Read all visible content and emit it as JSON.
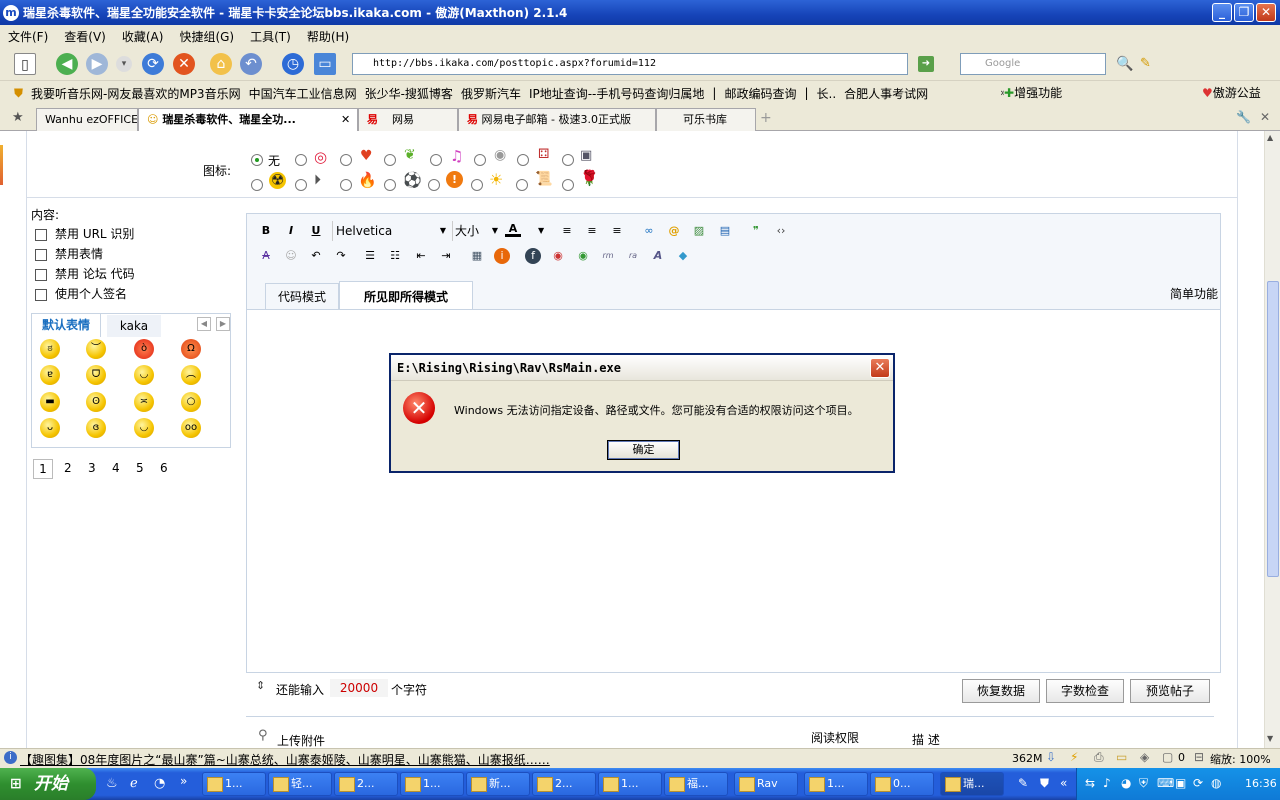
{
  "window": {
    "title": "瑞星杀毒软件、瑞星全功能安全软件 - 瑞星卡卡安全论坛bbs.ikaka.com - 傲游(Maxthon) 2.1.4",
    "app_icon": "maxthon-icon"
  },
  "menu": [
    "文件(F)",
    "查看(V)",
    "收藏(A)",
    "快捷组(G)",
    "工具(T)",
    "帮助(H)"
  ],
  "toolbar": {
    "url": "http://bbs.ikaka.com/posttopic.aspx?forumid=112",
    "search_placeholder": "Google"
  },
  "favorites": [
    "我要听音乐网-网友最喜欢的MP3音乐网",
    "中国汽车工业信息网",
    "张少华-搜狐博客",
    "俄罗斯汽车",
    "IP地址查询--手机号码查询归属地",
    "|",
    "邮政编码查询",
    "|",
    "长..",
    "合肥人事考试网",
    "增强功能",
    "傲游公益"
  ],
  "tabs": [
    "Wanhu ezOFFICE",
    "瑞星杀毒软件、瑞星全功...",
    "网易",
    "网易电子邮箱 - 极速3.0正式版",
    "可乐书库"
  ],
  "form": {
    "icon_label": "图标:",
    "icon_none": "无",
    "content_label": "内容:",
    "options": [
      "禁用 URL 识别",
      "禁用表情",
      "禁用 论坛 代码",
      "使用个人签名"
    ],
    "smiley_tabs": [
      "默认表情",
      "kaka"
    ],
    "smiley_pages": [
      "1",
      "2",
      "3",
      "4",
      "5",
      "6"
    ]
  },
  "editor": {
    "font": "Helvetica",
    "size": "大小",
    "mode_tabs": [
      "代码模式",
      "所见即所得模式"
    ],
    "simple_link": "简单功能",
    "remaining_label": "还能输入",
    "remaining_value": "20000",
    "remaining_unit": "个字符",
    "buttons": [
      "恢复数据",
      "字数检查",
      "预览帖子"
    ]
  },
  "attach": {
    "upload": "上传附件",
    "permission": "阅读权限",
    "desc": "描 述"
  },
  "dialog": {
    "title": "E:\\Rising\\Rising\\Rav\\RsMain.exe",
    "message": "Windows 无法访问指定设备、路径或文件。您可能没有合适的权限访问这个项目。",
    "ok": "确定"
  },
  "status": {
    "news": "【趣图集】08年度图片之“最山寨”篇~山寨总统、山寨泰姬陵、山寨明星、山寨熊猫、山寨报纸……",
    "memory": "362M",
    "count": "0",
    "zoom": "缩放: 100%"
  },
  "taskbar": {
    "start": "开始",
    "tasks": [
      "1...",
      "轻...",
      "2...",
      "1...",
      "新...",
      "2...",
      "1...",
      "福...",
      "Rav",
      "1...",
      "0...",
      "瑞..."
    ],
    "clock": "16:36"
  }
}
